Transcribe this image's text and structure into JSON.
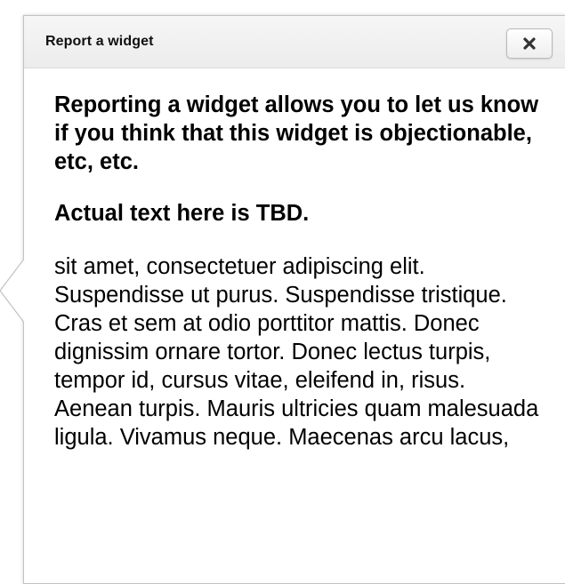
{
  "dialog": {
    "title": "Report a widget",
    "close_icon": "close-icon",
    "lead": "Reporting a widget allows you to let us know if you think that this widget is objectionable, etc, etc.",
    "subhead": "Actual text here is TBD.",
    "body": "sit amet, consectetuer adipiscing elit. Suspendisse ut purus. Suspendisse tristique. Cras et sem at odio porttitor mattis. Donec dignissim ornare tortor. Donec lectus turpis, tempor id, cursus vitae, eleifend in, risus. Aenean turpis. Mauris ultricies quam malesuada ligula. Vivamus neque. Maecenas arcu lacus,"
  }
}
